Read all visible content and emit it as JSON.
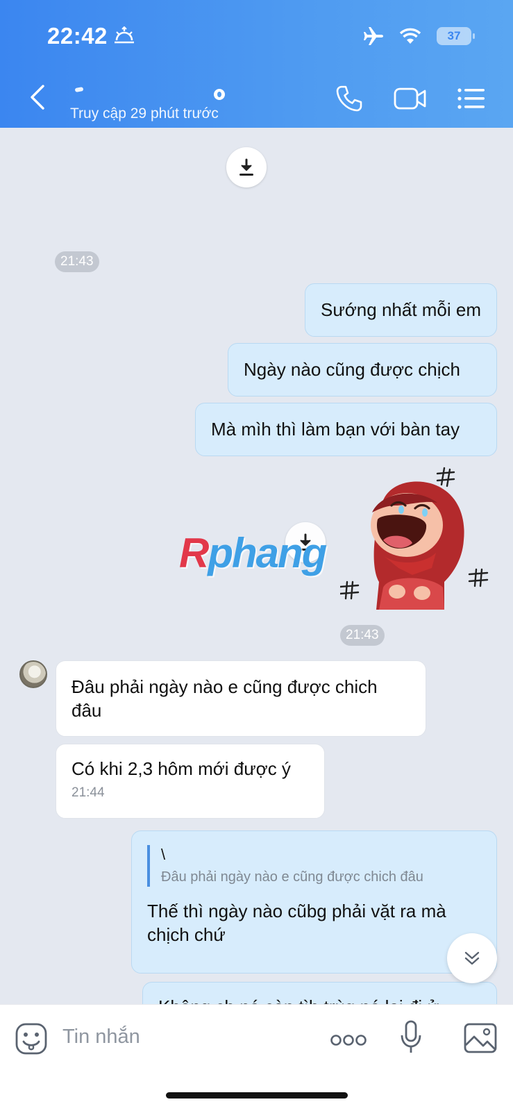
{
  "status_bar": {
    "time": "22:42",
    "battery": "37"
  },
  "header": {
    "subtitle": "Truy cập 29 phút trước"
  },
  "messages": {
    "ts1": "21:43",
    "out1": "Sướng nhất mỗi em",
    "out2": "Ngày nào cũng được chịch",
    "out3": "Mà mìh thì làm bạn với bàn tay",
    "ts2": "21:43",
    "in1": "Đâu phải ngày nào e cũng được chich đâu",
    "in2": "Có khi 2,3 hôm mới được ý",
    "in2_time": "21:44",
    "reply_quote_name": "\\",
    "reply_quote_text": "Đâu phải ngày nào e cũng được chich đâu",
    "reply_text": "Thế thì ngày nào cũbg phải vặt ra mà chịch chứ",
    "partial_text": "Không ch nó còn tìh trùg nó lại đi ử"
  },
  "watermark": {
    "first": "R",
    "rest": "phang"
  },
  "input": {
    "placeholder": "Tin nhắn"
  },
  "colors": {
    "header": "#4f9bf1",
    "bubble_out": "#d7ecfc",
    "bubble_in": "#ffffff",
    "background": "#e4e8f0"
  }
}
